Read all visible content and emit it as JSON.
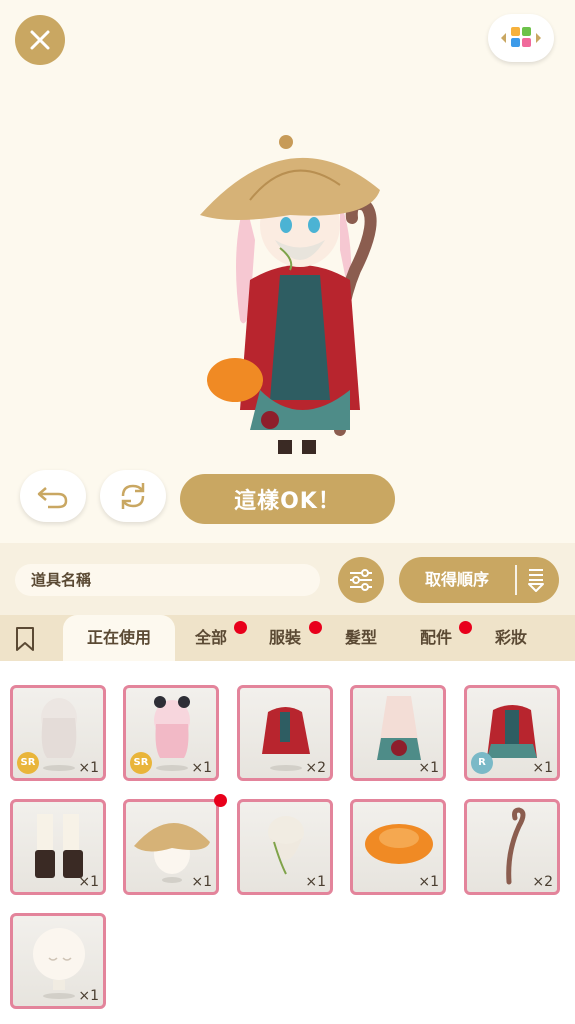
{
  "top": {
    "ok_label": "這樣OK！"
  },
  "filter": {
    "name_placeholder": "道具名稱",
    "sort_label": "取得順序"
  },
  "tabs": [
    {
      "label": "正在使用",
      "active": true,
      "dot": false
    },
    {
      "label": "全部",
      "active": false,
      "dot": true
    },
    {
      "label": "服裝",
      "active": false,
      "dot": true
    },
    {
      "label": "髮型",
      "active": false,
      "dot": false
    },
    {
      "label": "配件",
      "active": false,
      "dot": true
    },
    {
      "label": "彩妝",
      "active": false,
      "dot": false
    }
  ],
  "items": [
    {
      "name": "hair-white",
      "qty": "×1",
      "rarity": "SR"
    },
    {
      "name": "hair-pink",
      "qty": "×1",
      "rarity": "SR"
    },
    {
      "name": "red-cloak",
      "qty": "×2",
      "rarity": ""
    },
    {
      "name": "teal-skirt",
      "qty": "×1",
      "rarity": ""
    },
    {
      "name": "red-robe",
      "qty": "×1",
      "rarity": "R"
    },
    {
      "name": "boots",
      "qty": "×1",
      "rarity": ""
    },
    {
      "name": "straw-hat",
      "qty": "×1",
      "rarity": "",
      "new": true
    },
    {
      "name": "vine-beard",
      "qty": "×1",
      "rarity": ""
    },
    {
      "name": "orange-muff",
      "qty": "×1",
      "rarity": ""
    },
    {
      "name": "wooden-staff",
      "qty": "×2",
      "rarity": ""
    },
    {
      "name": "face-base",
      "qty": "×1",
      "rarity": ""
    }
  ],
  "colors": {
    "gold": "#c9a762",
    "card_border": "#e3849b",
    "dot": "#e8001b",
    "tab_bg": "#efe3c9"
  }
}
